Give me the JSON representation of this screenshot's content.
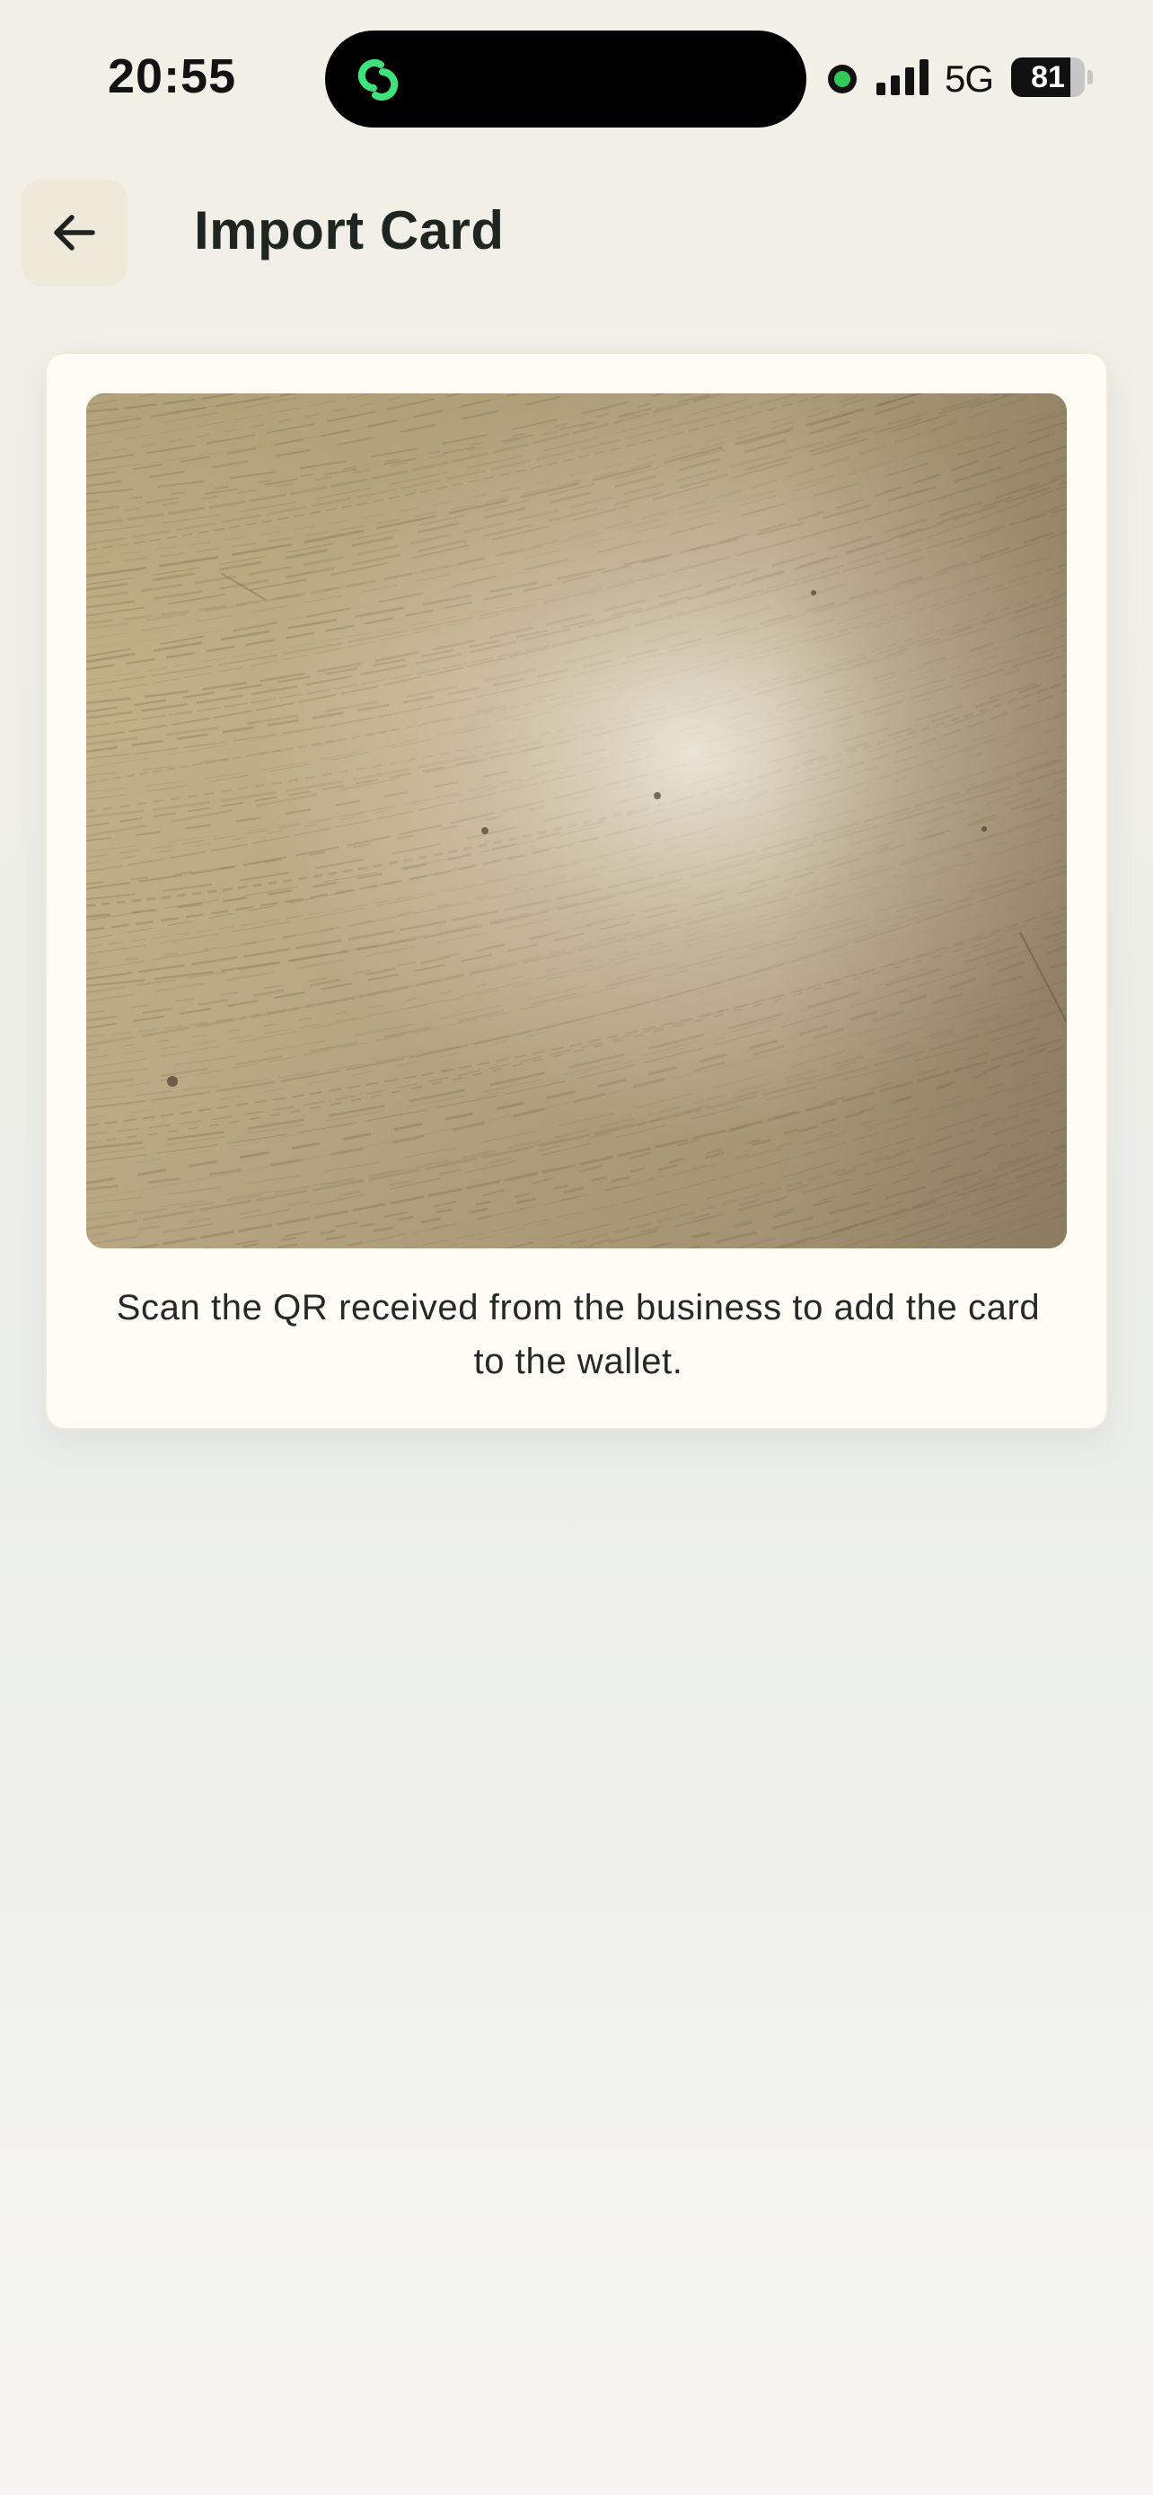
{
  "status_bar": {
    "time": "20:55",
    "network": "5G",
    "battery_level": "81",
    "battery_fraction": 0.81,
    "live_activity_icon": "linked-rings-icon",
    "camera_indicator_color": "#34c759"
  },
  "header": {
    "back_icon": "arrow-left-icon",
    "title": "Import Card"
  },
  "scanner": {
    "instructions": "Scan the QR received from the business to add the card to the wallet."
  },
  "colors": {
    "accent_green": "#3ee27a",
    "card_background": "#fffcf6",
    "back_button_background": "#efe9d9"
  }
}
